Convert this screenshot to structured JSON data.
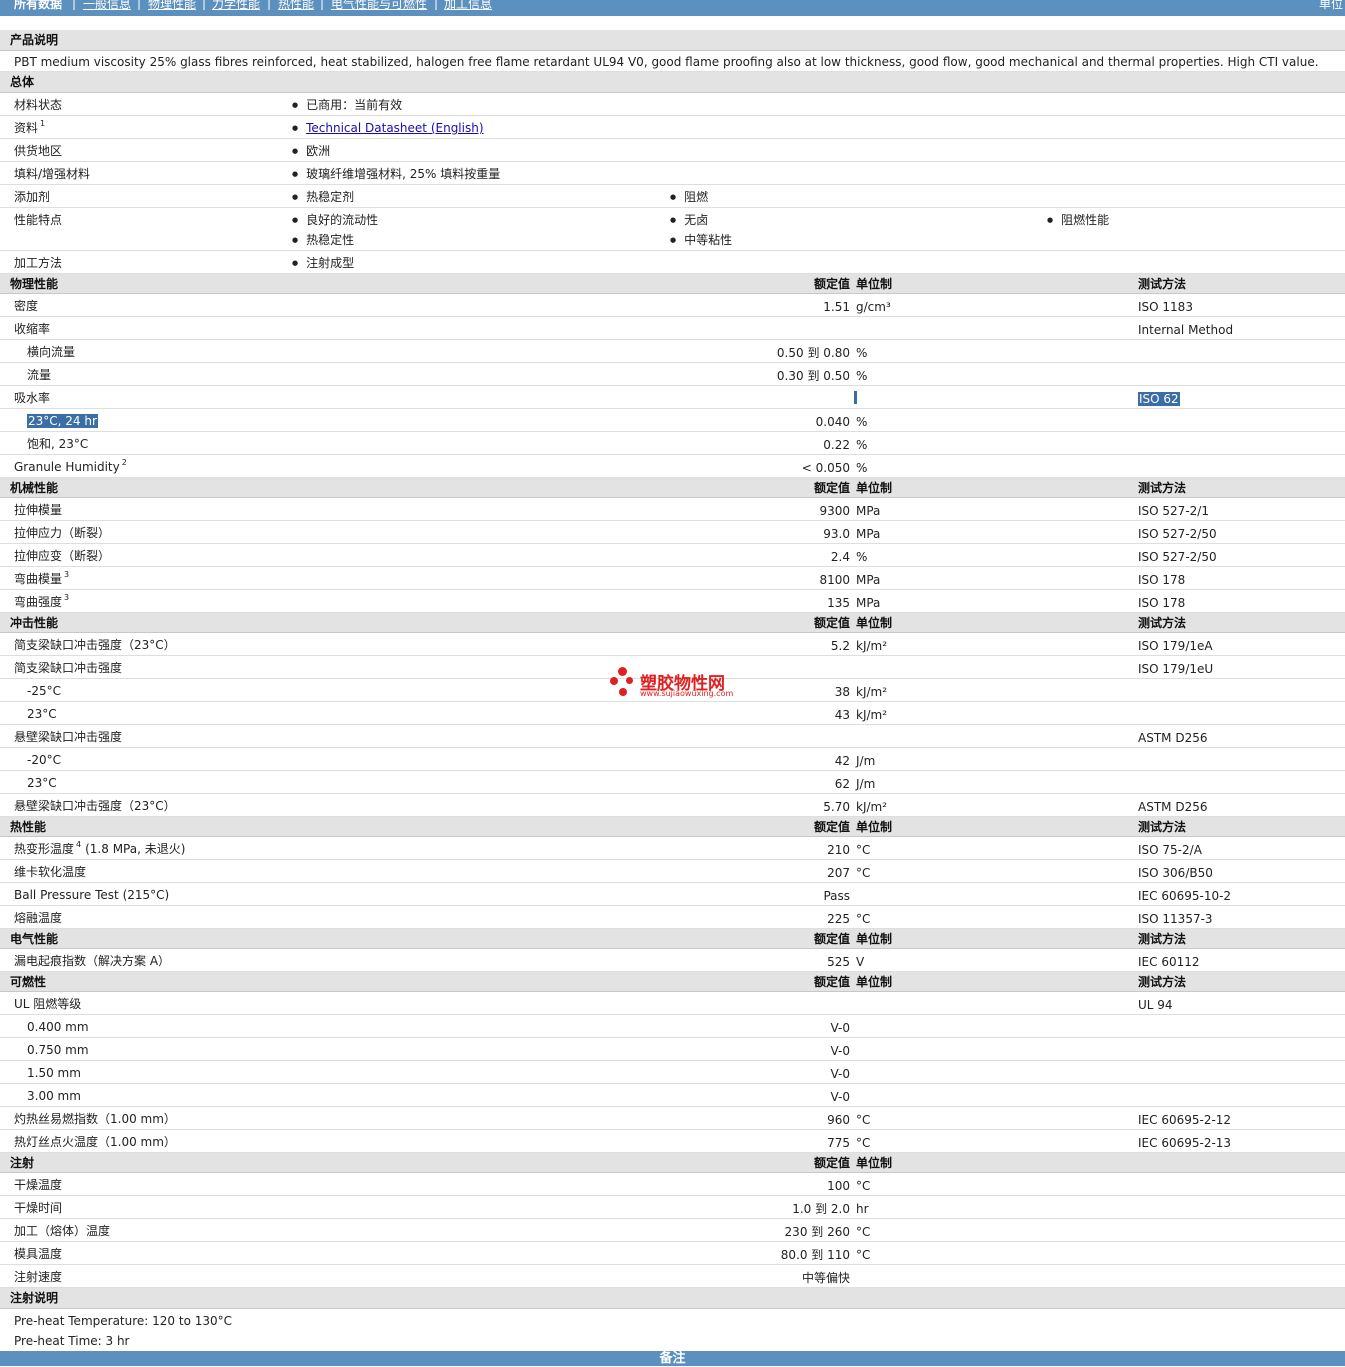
{
  "nav": {
    "tabs": [
      "所有数据",
      "一般信息",
      "物理性能",
      "力学性能",
      "热性能",
      "电气性能与可燃性",
      "加工信息"
    ],
    "unit": "单位"
  },
  "desc": {
    "title": "产品说明",
    "text": "PBT medium viscosity 25% glass fibres reinforced, heat stabilized, halogen free flame retardant UL94 V0, good flame proofing also at low thickness, good flow, good mechanical and thermal properties. High CTI value."
  },
  "general": {
    "title": "总体",
    "rows": [
      {
        "label": "材料状态",
        "items": [
          "已商用：当前有效"
        ]
      },
      {
        "label": "资料",
        "sup": "1",
        "items": [
          "Technical Datasheet (English)"
        ],
        "link": true
      },
      {
        "label": "供货地区",
        "items": [
          "欧洲"
        ]
      },
      {
        "label": "填料/增强材料",
        "items": [
          "玻璃纤维增强材料, 25% 填料按重量"
        ]
      },
      {
        "label": "添加剂",
        "items": [
          "热稳定剂",
          "阻燃"
        ]
      },
      {
        "label": "性能特点",
        "items": [
          "良好的流动性",
          "无卤",
          "阻燃性能",
          "热稳定性",
          "中等粘性"
        ]
      },
      {
        "label": "加工方法",
        "items": [
          "注射成型"
        ]
      }
    ]
  },
  "cols": {
    "nominal": "额定值",
    "unit": "单位制",
    "test": "测试方法"
  },
  "sections": [
    {
      "title": "物理性能",
      "test_header": true,
      "rows": [
        {
          "label": "密度",
          "value": "1.51",
          "unit": "g/cm³",
          "test": "ISO 1183"
        },
        {
          "label": "收缩率",
          "test": "Internal Method"
        },
        {
          "label": "横向流量",
          "indent": true,
          "value": "0.50 到 0.80",
          "unit": "%"
        },
        {
          "label": "流量",
          "indent": true,
          "value": "0.30 到 0.50",
          "unit": "%"
        },
        {
          "label": "吸水率",
          "test": "ISO 62",
          "sel_test": true,
          "bar": true
        },
        {
          "label": "23°C, 24 hr",
          "indent": true,
          "value": "0.040",
          "unit": "%",
          "sel_label": true
        },
        {
          "label": "饱和, 23°C",
          "indent": true,
          "value": "0.22",
          "unit": "%"
        },
        {
          "label": "Granule Humidity",
          "sup": "2",
          "value": "< 0.050",
          "unit": "%"
        }
      ]
    },
    {
      "title": "机械性能",
      "test_header": true,
      "rows": [
        {
          "label": "拉伸模量",
          "value": "9300",
          "unit": "MPa",
          "test": "ISO 527-2/1"
        },
        {
          "label": "拉伸应力（断裂）",
          "value": "93.0",
          "unit": "MPa",
          "test": "ISO 527-2/50"
        },
        {
          "label": "拉伸应变（断裂）",
          "value": "2.4",
          "unit": "%",
          "test": "ISO 527-2/50"
        },
        {
          "label": "弯曲模量",
          "sup": "3",
          "value": "8100",
          "unit": "MPa",
          "test": "ISO 178"
        },
        {
          "label": "弯曲强度",
          "sup": "3",
          "value": "135",
          "unit": "MPa",
          "test": "ISO 178"
        }
      ]
    },
    {
      "title": "冲击性能",
      "test_header": true,
      "rows": [
        {
          "label": "简支梁缺口冲击强度（23°C）",
          "value": "5.2",
          "unit": "kJ/m²",
          "test": "ISO 179/1eA"
        },
        {
          "label": "简支梁缺口冲击强度",
          "test": "ISO 179/1eU"
        },
        {
          "label": "-25°C",
          "indent": true,
          "value": "38",
          "unit": "kJ/m²"
        },
        {
          "label": "23°C",
          "indent": true,
          "value": "43",
          "unit": "kJ/m²"
        },
        {
          "label": "悬壁梁缺口冲击强度",
          "test": "ASTM D256"
        },
        {
          "label": "-20°C",
          "indent": true,
          "value": "42",
          "unit": "J/m"
        },
        {
          "label": "23°C",
          "indent": true,
          "value": "62",
          "unit": "J/m"
        },
        {
          "label": "悬壁梁缺口冲击强度（23°C）",
          "value": "5.70",
          "unit": "kJ/m²",
          "test": "ASTM D256"
        }
      ]
    },
    {
      "title": "热性能",
      "test_header": true,
      "rows": [
        {
          "label": "热变形温度",
          "sup": "4",
          "suffix": "(1.8 MPa, 未退火)",
          "value": "210",
          "unit": "°C",
          "test": "ISO 75-2/A"
        },
        {
          "label": "维卡软化温度",
          "value": "207",
          "unit": "°C",
          "test": "ISO 306/B50"
        },
        {
          "label": "Ball Pressure Test (215°C)",
          "value": "Pass",
          "test": "IEC 60695-10-2"
        },
        {
          "label": "熔融温度",
          "value": "225",
          "unit": "°C",
          "test": "ISO 11357-3"
        }
      ]
    },
    {
      "title": "电气性能",
      "test_header": true,
      "rows": [
        {
          "label": "漏电起痕指数（解决方案 A）",
          "value": "525",
          "unit": "V",
          "test": "IEC 60112"
        }
      ]
    },
    {
      "title": "可燃性",
      "test_header": true,
      "rows": [
        {
          "label": "UL 阻燃等级",
          "test": "UL 94"
        },
        {
          "label": "0.400 mm",
          "indent": true,
          "value": "V-0"
        },
        {
          "label": "0.750 mm",
          "indent": true,
          "value": "V-0"
        },
        {
          "label": "1.50 mm",
          "indent": true,
          "value": "V-0"
        },
        {
          "label": "3.00 mm",
          "indent": true,
          "value": "V-0"
        },
        {
          "label": "灼热丝易燃指数（1.00 mm）",
          "value": "960",
          "unit": "°C",
          "test": "IEC 60695-2-12"
        },
        {
          "label": "热灯丝点火温度（1.00 mm）",
          "value": "775",
          "unit": "°C",
          "test": "IEC 60695-2-13"
        }
      ]
    },
    {
      "title": "注射",
      "test_header": false,
      "rows": [
        {
          "label": "干燥温度",
          "value": "100",
          "unit": "°C"
        },
        {
          "label": "干燥时间",
          "value": "1.0 到 2.0",
          "unit": "hr"
        },
        {
          "label": "加工（熔体）温度",
          "value": "230 到 260",
          "unit": "°C"
        },
        {
          "label": "模具温度",
          "value": "80.0 到 110",
          "unit": "°C"
        },
        {
          "label": "注射速度",
          "value": "中等偏快"
        }
      ]
    }
  ],
  "notes": {
    "title": "注射说明",
    "lines": [
      "Pre-heat Temperature: 120 to 130°C",
      "Pre-heat Time: 3 hr"
    ]
  },
  "watermark": {
    "cn": "塑胶物性网",
    "url": "www.sujiaowuxing.com"
  },
  "footer": "备注",
  "colors": {
    "nav": "#5b90bf",
    "header_row": "#e3e3e3",
    "selection": "#3a6ea5",
    "watermark": "#e02020"
  }
}
